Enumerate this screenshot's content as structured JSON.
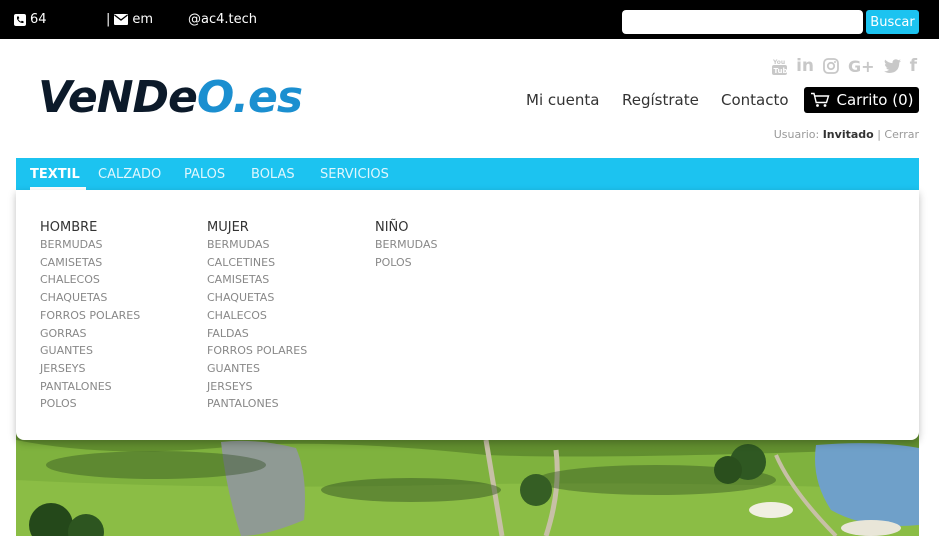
{
  "topbar": {
    "phone": "64",
    "email_sep": "|",
    "email": "em",
    "handle": "@ac4.tech",
    "search_placeholder": "",
    "search_button": "Buscar"
  },
  "logo": {
    "part1": "VeNDe",
    "part2": "O.es"
  },
  "social": [
    "youtube-icon",
    "linkedin-icon",
    "instagram-icon",
    "google-plus-icon",
    "twitter-icon",
    "facebook-icon"
  ],
  "nav": {
    "account": "Mi cuenta",
    "register": "Regístrate",
    "contact": "Contacto",
    "cart": "Carrito (0)"
  },
  "user": {
    "label": "Usuario:",
    "name": "Invitado",
    "sep": "|",
    "logout": "Cerrar"
  },
  "menu": {
    "items": [
      "TEXTIL",
      "CALZADO",
      "PALOS",
      "BOLAS",
      "SERVICIOS"
    ],
    "active": "TEXTIL"
  },
  "dropdown": {
    "columns": [
      {
        "title": "HOMBRE",
        "items": [
          "BERMUDAS",
          "CAMISETAS",
          "CHALECOS",
          "CHAQUETAS",
          "FORROS POLARES",
          "GORRAS",
          "GUANTES",
          "JERSEYS",
          "PANTALONES",
          "POLOS"
        ]
      },
      {
        "title": "MUJER",
        "items": [
          "BERMUDAS",
          "CALCETINES",
          "CAMISETAS",
          "CHAQUETAS",
          "CHALECOS",
          "FALDAS",
          "FORROS POLARES",
          "GUANTES",
          "JERSEYS",
          "PANTALONES"
        ]
      },
      {
        "title": "NIÑO",
        "items": [
          "BERMUDAS",
          "POLOS"
        ]
      }
    ]
  },
  "colors": {
    "accent": "#1cc3f0",
    "topbar": "#000000",
    "logo_dark": "#0c1a2a",
    "logo_blue": "#1b8fd0"
  }
}
